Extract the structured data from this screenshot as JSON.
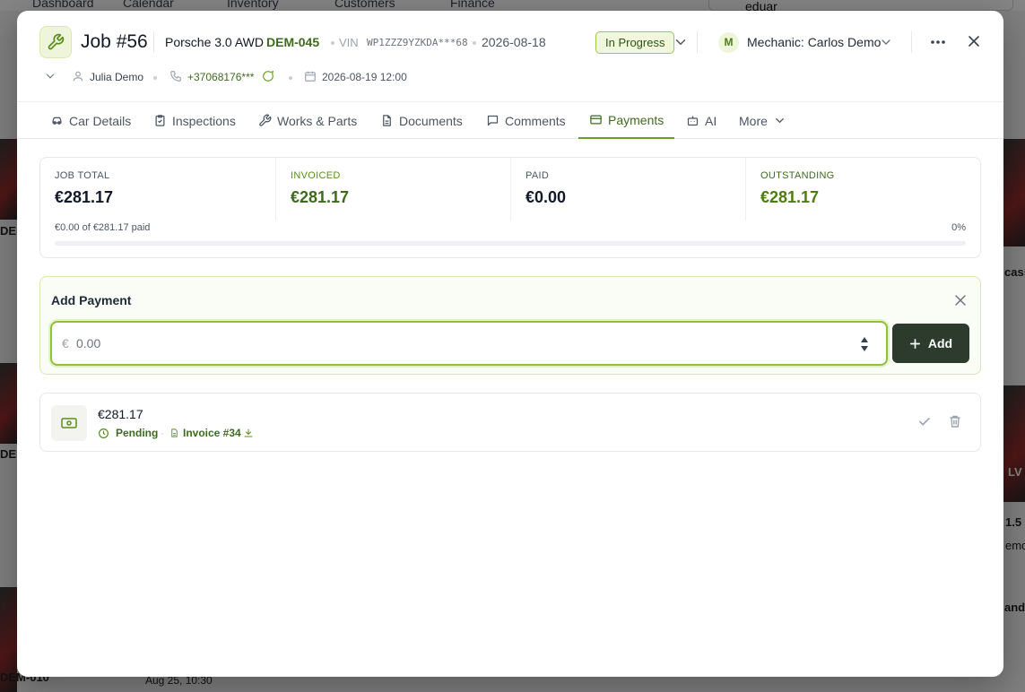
{
  "background": {
    "nav": [
      "Dashboard",
      "Calendar",
      "Inventory",
      "Customers",
      "Finance"
    ],
    "search_value": "eduar",
    "card_fragments": [
      "DEM",
      "DEM",
      "DEM-010",
      "Aug 25, 10:30",
      "cass",
      "1.5",
      "emo",
      "and",
      "LV"
    ]
  },
  "job": {
    "title": "Job #56",
    "car_model": "Porsche 3.0 AWD",
    "plate": "DEM-045",
    "vin_label": "VIN",
    "vin": "WP1ZZZ9YZKDA***68",
    "date": "2026-08-18",
    "status": "In Progress",
    "mechanic_initial": "M",
    "mechanic": "Mechanic: Carlos Demo",
    "customer": "Julia Demo",
    "phone": "+37068176***",
    "appointment": "2026-08-19 12:00"
  },
  "tabs": [
    {
      "label": "Car Details",
      "icon": "car-icon"
    },
    {
      "label": "Inspections",
      "icon": "clipboard-check-icon"
    },
    {
      "label": "Works & Parts",
      "icon": "wrench-icon"
    },
    {
      "label": "Documents",
      "icon": "document-icon"
    },
    {
      "label": "Comments",
      "icon": "comment-icon"
    },
    {
      "label": "Payments",
      "icon": "credit-card-icon"
    },
    {
      "label": "AI",
      "icon": "robot-icon"
    },
    {
      "label": "More",
      "icon": "chevron-down-icon"
    }
  ],
  "active_tab": "Payments",
  "summary": {
    "job_total_label": "JOB TOTAL",
    "job_total": "€281.17",
    "invoiced_label": "INVOICED",
    "invoiced": "€281.17",
    "paid_label": "PAID",
    "paid": "€0.00",
    "outstanding_label": "OUTSTANDING",
    "outstanding": "€281.17",
    "progress_text": "€0.00 of €281.17 paid",
    "progress_pct": "0%",
    "progress_fraction": 0
  },
  "add_payment": {
    "title": "Add Payment",
    "currency": "€",
    "amount_placeholder": "0.00",
    "amount_value": "",
    "add_label": "Add"
  },
  "payments": [
    {
      "amount": "€281.17",
      "status": "Pending",
      "invoice": "Invoice #34"
    }
  ],
  "colors": {
    "accent": "#6a9f24",
    "accent_dark": "#3d6b1e",
    "add_button": "#2d3b2c",
    "status_badge_bg": "#f0f7dc"
  }
}
